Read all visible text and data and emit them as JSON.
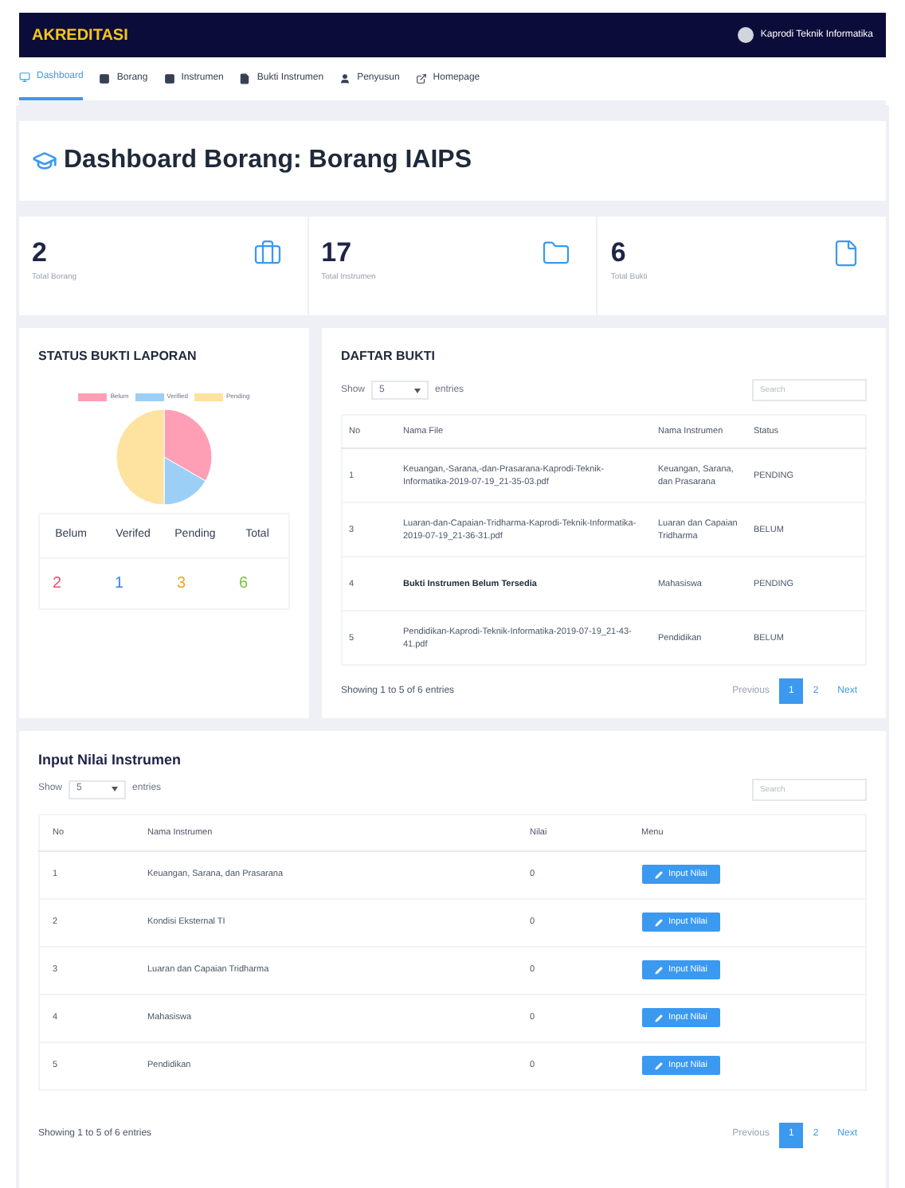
{
  "header": {
    "logo": "AKREDITASI",
    "user": "Kaprodi Teknik Informatika"
  },
  "nav": [
    {
      "label": "Dashboard",
      "selected": true
    },
    {
      "label": "Borang",
      "selected": false
    },
    {
      "label": "Instrumen",
      "selected": false
    },
    {
      "label": "Bukti Instrumen",
      "selected": false
    },
    {
      "label": "Penyusun",
      "selected": false
    },
    {
      "label": "Homepage",
      "selected": false
    }
  ],
  "page_title": "Dashboard Borang: Borang IAIPS",
  "stats": [
    {
      "value": "2",
      "label": "Total Borang"
    },
    {
      "value": "17",
      "label": "Total Instrumen"
    },
    {
      "value": "6",
      "label": "Total Bukti"
    }
  ],
  "status_panel": {
    "title": "STATUS BUKTI LAPORAN",
    "chart_data": {
      "type": "pie",
      "categories": [
        "Belum",
        "Verified",
        "Pending"
      ],
      "values": [
        33.33,
        16.67,
        50
      ],
      "colors": [
        "#ff9fb5",
        "#9ccff5",
        "#fde2a0"
      ]
    },
    "summary": [
      {
        "label": "Belum",
        "value": "2",
        "color": "#f0506e"
      },
      {
        "label": "Verifed",
        "value": "1",
        "color": "#3b82f6"
      },
      {
        "label": "Pending",
        "value": "3",
        "color": "#f5a623"
      },
      {
        "label": "Total",
        "value": "6",
        "color": "#7ac143"
      }
    ]
  },
  "daftar_bukti": {
    "title": "DAFTAR BUKTI",
    "show_label": "Show",
    "show_value": "5",
    "entries_label": "entries",
    "search": {
      "placeholder": "Search"
    },
    "columns": [
      "No",
      "Nama File",
      "Nama Instrumen",
      "Status"
    ],
    "rows": [
      {
        "no": "1",
        "file": "Keuangan,-Sarana,-dan-Prasarana-Kaprodi-Teknik-Informatika-2019-07-19_21-35-03.pdf",
        "missing": false,
        "instrumen": "Keuangan, Sarana, dan Prasarana",
        "status": "PENDING"
      },
      {
        "no": "3",
        "file": "Luaran-dan-Capaian-Tridharma-Kaprodi-Teknik-Informatika-2019-07-19_21-36-31.pdf",
        "missing": false,
        "instrumen": "Luaran dan Capaian Tridharma",
        "status": "BELUM"
      },
      {
        "no": "4",
        "file": "Bukti Instrumen Belum Tersedia",
        "missing": true,
        "instrumen": "Mahasiswa",
        "status": "PENDING"
      },
      {
        "no": "5",
        "file": "Pendidikan-Kaprodi-Teknik-Informatika-2019-07-19_21-43-41.pdf",
        "missing": false,
        "instrumen": "Pendidikan",
        "status": "BELUM"
      }
    ],
    "info": "Showing 1 to 5 of 6 entries",
    "pagination": [
      {
        "label": "Previous",
        "kind": "prev",
        "selected": false
      },
      {
        "label": "1",
        "kind": "page",
        "selected": true
      },
      {
        "label": "2",
        "kind": "page",
        "selected": false
      },
      {
        "label": "Next",
        "kind": "next",
        "selected": false
      }
    ]
  },
  "input_nilai": {
    "title": "Input Nilai Instrumen",
    "show_label": "Show",
    "show_value": "5",
    "entries_label": "entries",
    "search": {
      "placeholder": "Search"
    },
    "columns": [
      "No",
      "Nama Instrumen",
      "Nilai",
      "Menu"
    ],
    "rows": [
      {
        "no": "1",
        "nama": "Keuangan, Sarana, dan Prasarana",
        "nilai": "0",
        "button": "Input Nilai"
      },
      {
        "no": "2",
        "nama": "Kondisi Eksternal TI",
        "nilai": "0",
        "button": "Input Nilai"
      },
      {
        "no": "3",
        "nama": "Luaran dan Capaian Tridharma",
        "nilai": "0",
        "button": "Input Nilai"
      },
      {
        "no": "4",
        "nama": "Mahasiswa",
        "nilai": "0",
        "button": "Input Nilai"
      },
      {
        "no": "5",
        "nama": "Pendidikan",
        "nilai": "0",
        "button": "Input Nilai"
      }
    ],
    "info": "Showing 1 to 5 of 6 entries",
    "pagination": [
      {
        "label": "Previous",
        "kind": "prev",
        "selected": false
      },
      {
        "label": "1",
        "kind": "page",
        "selected": true
      },
      {
        "label": "2",
        "kind": "page",
        "selected": false
      },
      {
        "label": "Next",
        "kind": "next",
        "selected": false
      }
    ]
  }
}
